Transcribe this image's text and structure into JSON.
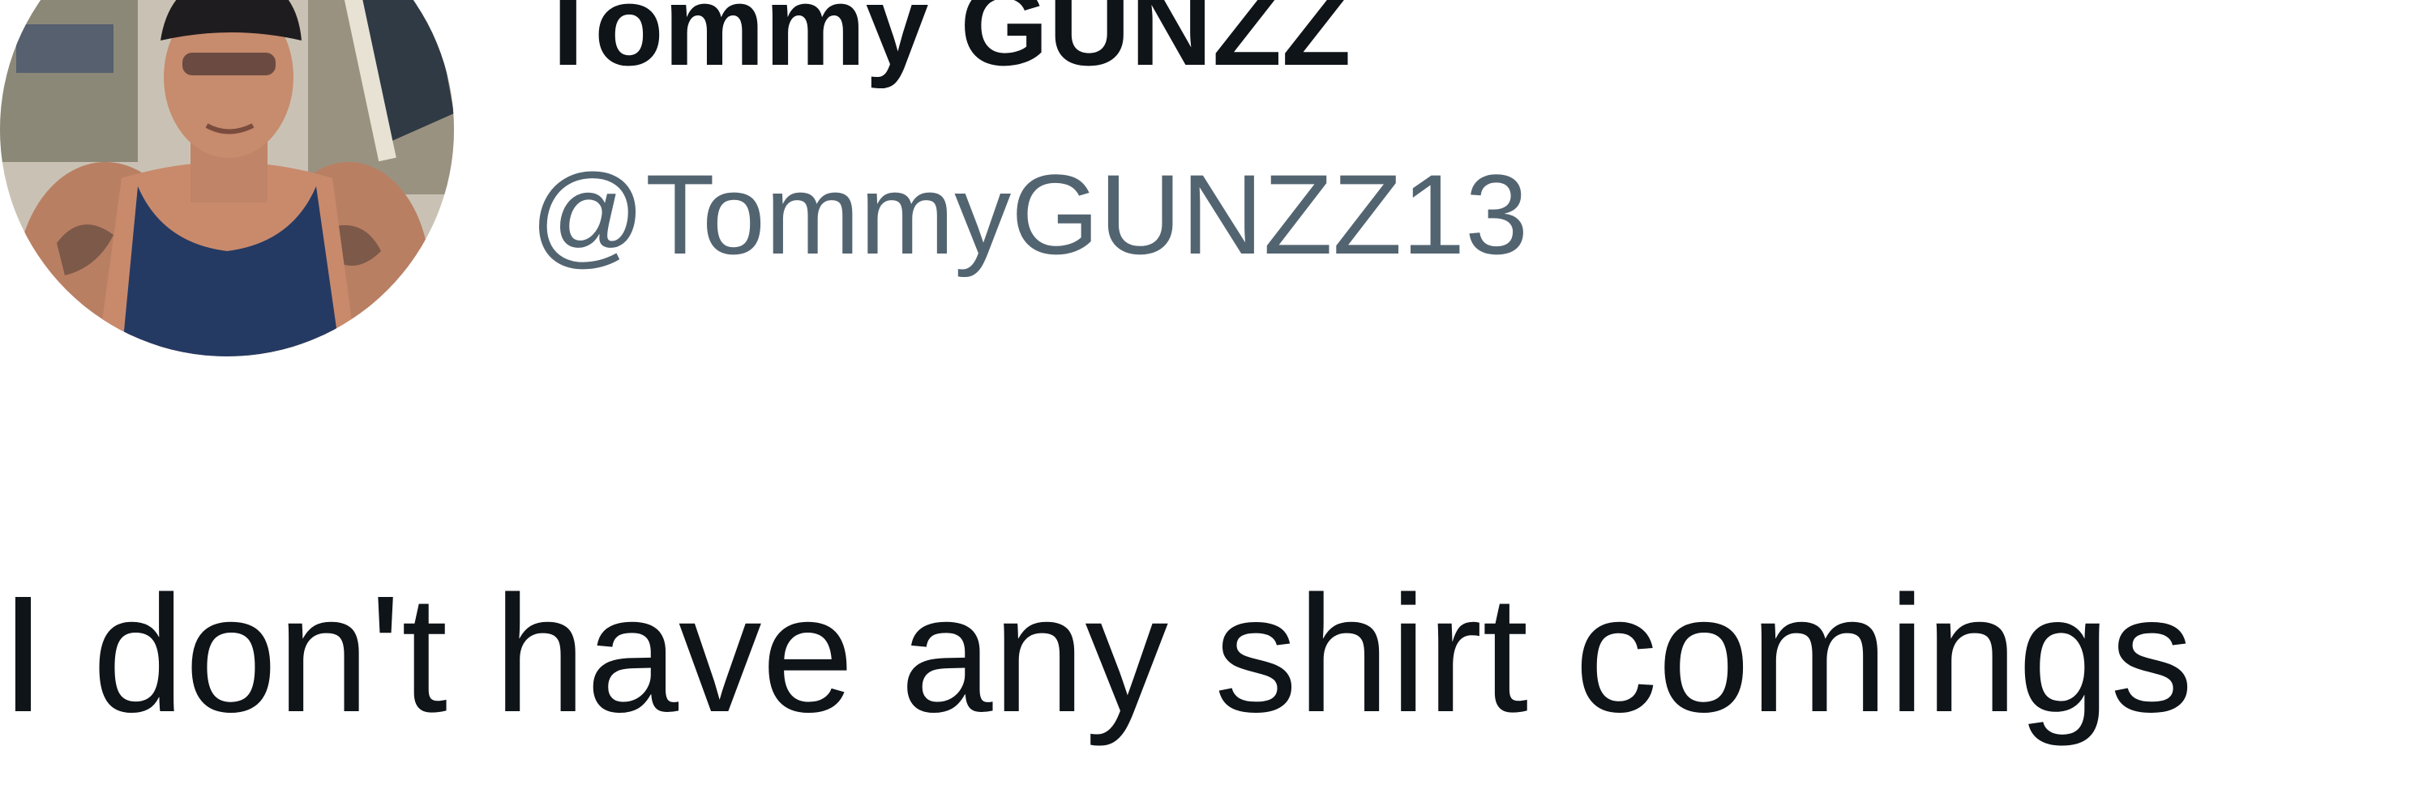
{
  "tweet": {
    "author": {
      "display_name": "Tommy GUNZZ",
      "handle": "@TommyGUNZZ13",
      "avatar_icon": "profile-photo"
    },
    "text": "I don't have any shirt comings"
  },
  "colors": {
    "name": "#0f1419",
    "handle": "#536471",
    "text": "#0f1419",
    "background": "#ffffff"
  }
}
